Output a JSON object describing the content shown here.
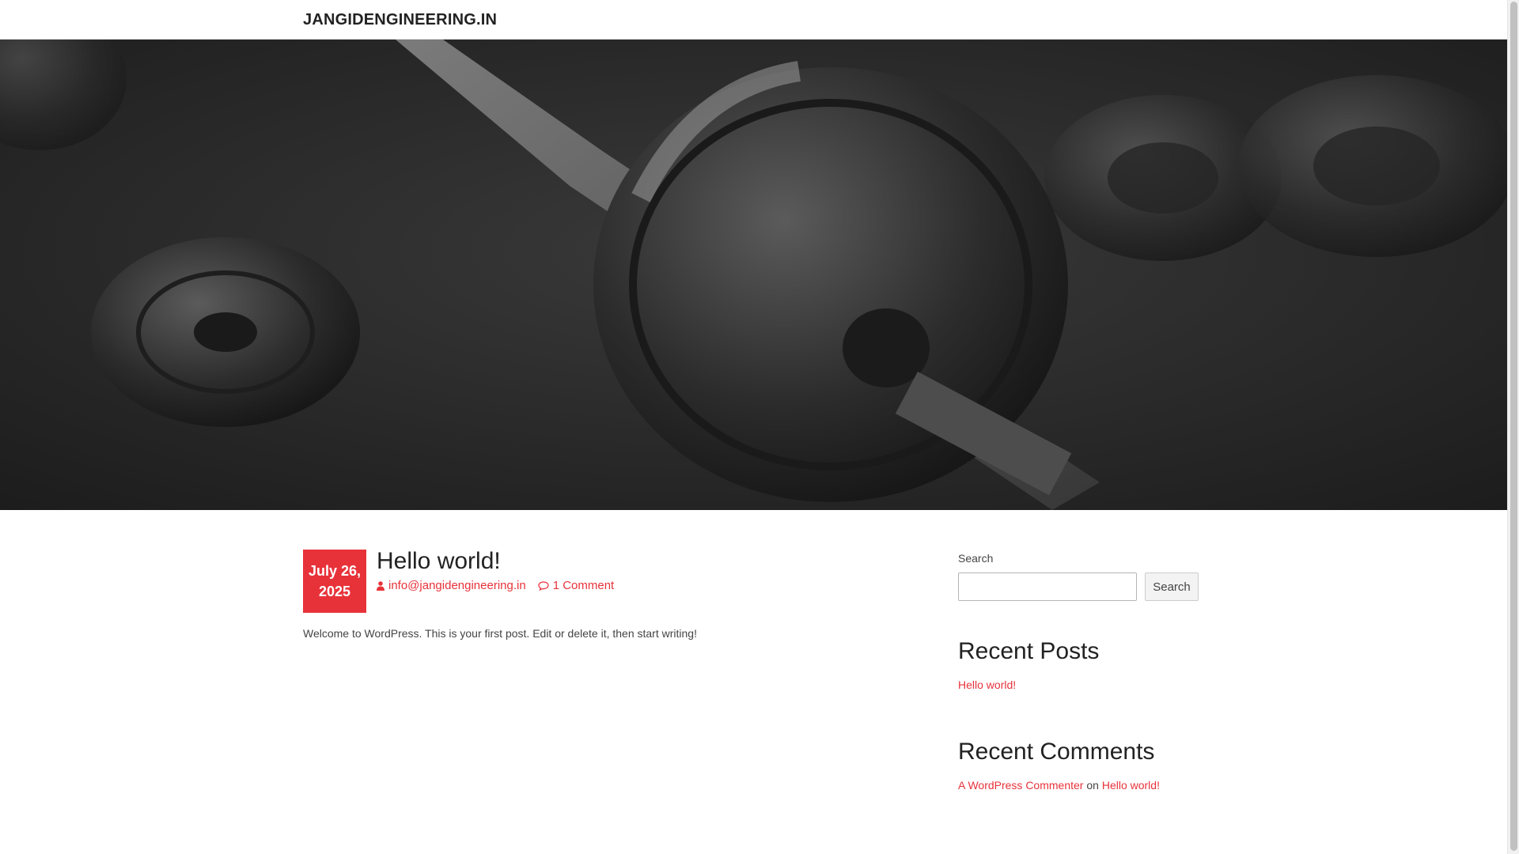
{
  "header": {
    "site_title": "JANGIDENGINEERING.IN"
  },
  "hero": {
    "image_description": "dark barbell and weight plates on gym floor",
    "overlay_color": "#2d2d2d"
  },
  "post": {
    "date_line1": "July 26,",
    "date_line2": "2025",
    "title": "Hello world!",
    "author": "info@jangidengineering.in",
    "comments": "1 Comment",
    "excerpt": "Welcome to WordPress. This is your first post. Edit or delete it, then start writing!"
  },
  "sidebar": {
    "search": {
      "label": "Search",
      "value": "",
      "button_label": "Search"
    },
    "recent_posts": {
      "title": "Recent Posts",
      "items": [
        "Hello world!"
      ]
    },
    "recent_comments": {
      "title": "Recent Comments",
      "author": "A WordPress Commenter",
      "on_word": "on",
      "post": "Hello world!"
    }
  },
  "colors": {
    "accent": "#e8323a",
    "text": "#222222",
    "muted": "#444444"
  },
  "icons": {
    "author": "user-icon",
    "comments": "comment-icon"
  }
}
